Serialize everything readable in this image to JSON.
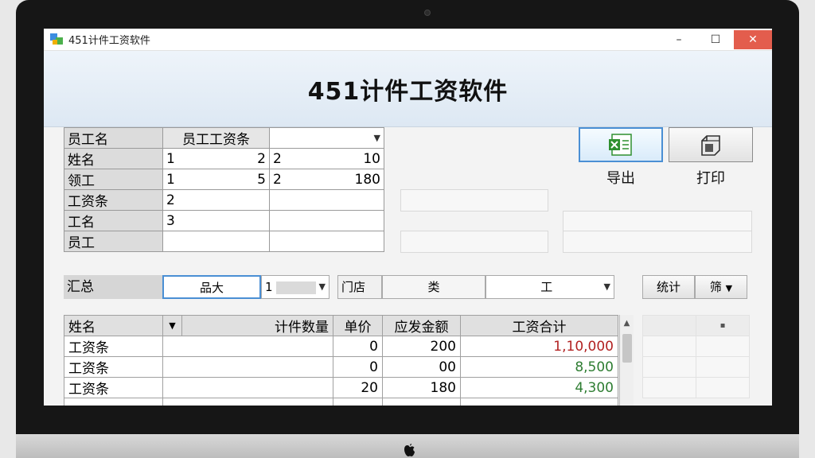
{
  "window": {
    "title": "451计件工资软件",
    "controls": {
      "minimize": "–",
      "maximize": "☐",
      "close": "✕"
    }
  },
  "banner": {
    "title": "451计件工资软件"
  },
  "top_grid": {
    "row_labels": [
      "员工名",
      "姓名",
      "领工",
      "工资条",
      "工名",
      "员工"
    ],
    "header_tab": "员工工资条",
    "dropdown_value": "",
    "rows": [
      {
        "a_left": "1",
        "a_right": "2",
        "b_left": "2",
        "b_right": "10"
      },
      {
        "a_left": "1",
        "a_right": "5",
        "b_left": "2",
        "b_right": "180"
      },
      {
        "a_left": "2",
        "a_right": "",
        "b_left": "",
        "b_right": ""
      },
      {
        "a_left": "3",
        "a_right": "",
        "b_left": "",
        "b_right": ""
      },
      {
        "a_left": "",
        "a_right": "",
        "b_left": "",
        "b_right": ""
      }
    ]
  },
  "toolbar": {
    "export_label": "导出",
    "print_label": "打印",
    "export_icon": "excel-export-icon",
    "print_icon": "printer-icon"
  },
  "summary": {
    "label": "汇总",
    "field1": "品大",
    "field2": "1",
    "field3": "门店",
    "field4": "类",
    "field5": "工",
    "button1": "统计",
    "button2": "筛"
  },
  "bottom_table": {
    "columns": [
      "姓名",
      "",
      "计件数量",
      "单价",
      "应发金额",
      "工资合计"
    ],
    "rows": [
      {
        "name": "工资条",
        "qty": "",
        "price": "0",
        "amount": "200",
        "total": "1,10,000",
        "total_color": "red"
      },
      {
        "name": "工资条",
        "qty": "",
        "price": "0",
        "amount": "00",
        "total": "8,500",
        "total_color": "green"
      },
      {
        "name": "工资条",
        "qty": "",
        "price": "20",
        "amount": "180",
        "total": "4,300",
        "total_color": "green"
      }
    ]
  },
  "colors": {
    "accent": "#4a8fd4",
    "close_button": "#e35d4d",
    "red_value": "#b22222",
    "green_value": "#2e7d32"
  }
}
